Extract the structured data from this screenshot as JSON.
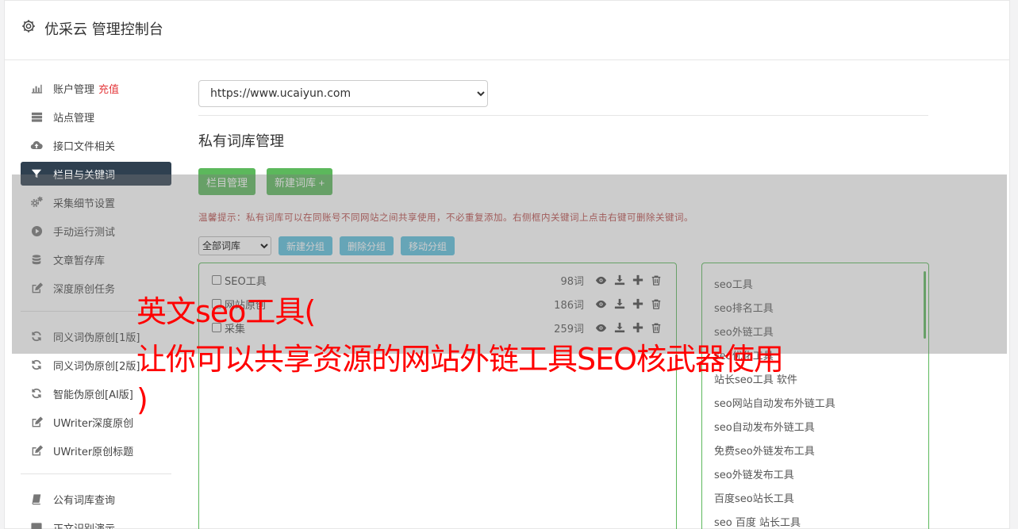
{
  "header": {
    "title": "优采云 管理控制台"
  },
  "sidebar": {
    "group1": [
      {
        "icon": "bar-chart-icon",
        "label": "账户管理",
        "extra": "充值"
      },
      {
        "icon": "server-icon",
        "label": "站点管理"
      },
      {
        "icon": "cloud-upload-icon",
        "label": "接口文件相关"
      },
      {
        "icon": "filter-icon",
        "label": "栏目与关键词",
        "active": true
      },
      {
        "icon": "cogs-icon",
        "label": "采集细节设置"
      },
      {
        "icon": "play-circle-icon",
        "label": "手动运行测试"
      },
      {
        "icon": "database-icon",
        "label": "文章暂存库"
      },
      {
        "icon": "edit-icon",
        "label": "深度原创任务"
      }
    ],
    "group2": [
      {
        "icon": "refresh-icon",
        "label": "同义词伪原创[1版]"
      },
      {
        "icon": "refresh-icon",
        "label": "同义词伪原创[2版]"
      },
      {
        "icon": "refresh-icon",
        "label": "智能伪原创[AI版]"
      },
      {
        "icon": "edit-icon",
        "label": "UWriter深度原创"
      },
      {
        "icon": "edit-icon",
        "label": "UWriter原创标题"
      }
    ],
    "group3": [
      {
        "icon": "book-icon",
        "label": "公有词库查询"
      },
      {
        "icon": "monitor-icon",
        "label": "正文识别演示"
      }
    ]
  },
  "main": {
    "site_select": "https://www.ucaiyun.com",
    "title": "私有词库管理",
    "btn_column": "栏目管理",
    "btn_new_lib": "新建词库 +",
    "tip": "温馨提示：私有词库可以在同账号不同网站之间共享使用，不必重复添加。右侧框内关键词上点击右键可删除关键词。",
    "group_select": "全部词库",
    "btn_new_group": "新建分组",
    "btn_del_group": "删除分组",
    "btn_move_group": "移动分组",
    "libraries": [
      {
        "name": "SEO工具",
        "count": "98词"
      },
      {
        "name": "网站原创",
        "count": "186词"
      },
      {
        "name": "采集",
        "count": "259词"
      }
    ],
    "keywords": [
      "seo工具",
      "seo排名工具",
      "seo外链工具",
      "seo优化工具",
      "站长seo工具 软件",
      "seo网站自动发布外链工具",
      "seo自动发布外链工具",
      "免费seo外链发布工具",
      "seo外链发布工具",
      "百度seo站长工具",
      "seo 百度 站长工具"
    ]
  },
  "overlay": {
    "line1": "英文seo工具(",
    "line2": "让你可以共享资源的网站外链工具SEO核武器使用",
    "line3": ")"
  },
  "colors": {
    "accent_green": "#5cb85c",
    "info_blue": "#5bc0de",
    "active_nav": "#2f4050",
    "overlay_text": "#ff0000"
  }
}
